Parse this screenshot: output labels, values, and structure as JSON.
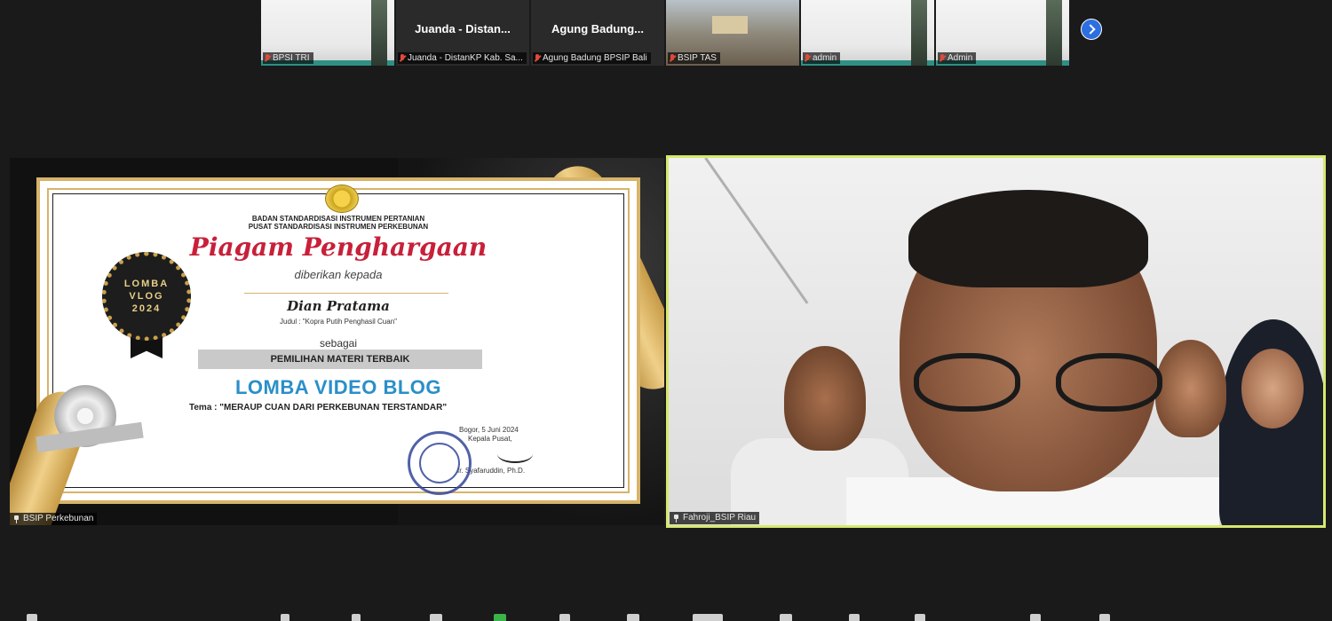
{
  "gallery": {
    "tiles": [
      {
        "kind": "slide",
        "label": "BPSI TRI",
        "muted": true,
        "center_name": ""
      },
      {
        "kind": "text",
        "label": "Juanda - DistanKP Kab. Sa...",
        "muted": true,
        "center_name": "Juanda - Distan..."
      },
      {
        "kind": "text",
        "label": "Agung Badung BPSIP Bali",
        "muted": true,
        "center_name": "Agung Badung..."
      },
      {
        "kind": "room",
        "label": "BSIP TAS",
        "muted": true,
        "center_name": ""
      },
      {
        "kind": "slide",
        "label": "admin",
        "muted": true,
        "center_name": ""
      },
      {
        "kind": "slide",
        "label": "Admin",
        "muted": true,
        "center_name": ""
      }
    ],
    "next_icon": "chevron-right-icon",
    "accent_color": "#2d6fe0"
  },
  "share": {
    "name": "BSIP Perkebunan",
    "certificate": {
      "org_line1": "BADAN STANDARDISASI INSTRUMEN PERTANIAN",
      "org_line2": "PUSAT STANDARDISASI INSTRUMEN PERKEBUNAN",
      "title": "Piagam Penghargaan",
      "given_to": "diberikan kepada",
      "recipient": "Dian Pratama",
      "judul": "Judul : \"Kopra Putih Penghasil Cuan\"",
      "sebagai": "sebagai",
      "category": "PEMILIHAN MATERI TERBAIK",
      "event": "LOMBA VIDEO BLOG",
      "tema": "Tema : \"MERAUP CUAN DARI PERKEBUNAN TERSTANDAR\"",
      "place_date": "Bogor, 5 Juni 2024",
      "signer_role": "Kepala Pusat,",
      "signer_name": "Ir. Syafaruddin, Ph.D.",
      "badge_lines": [
        "LOMBA",
        "VLOG",
        "2024"
      ]
    }
  },
  "speaker": {
    "name": "Fahroji_BSIP Riau",
    "active_border_color": "#d7e86e"
  }
}
